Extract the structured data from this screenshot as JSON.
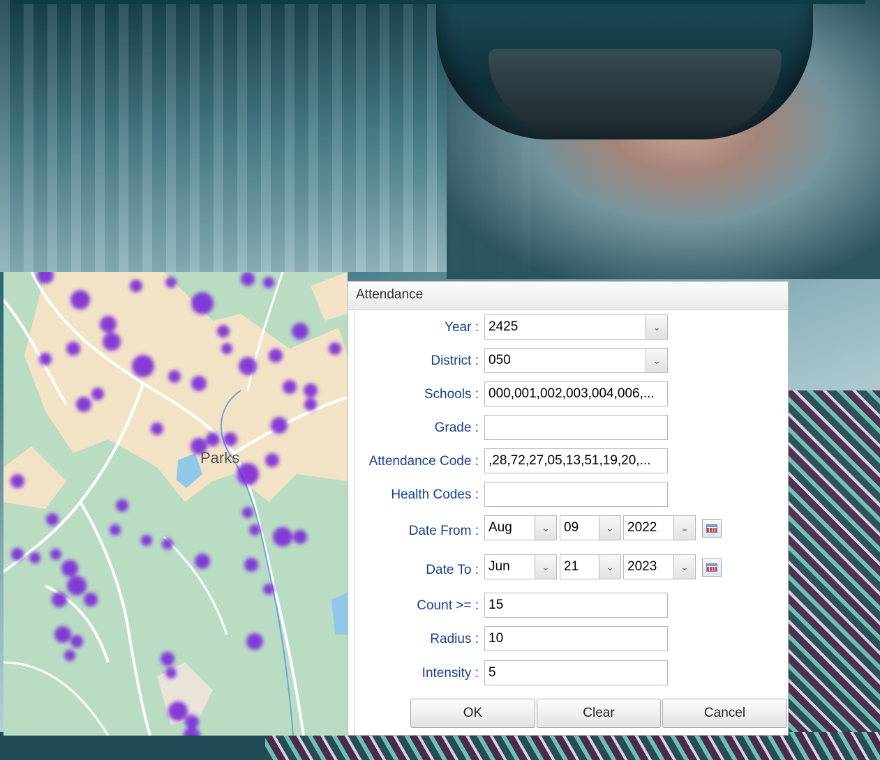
{
  "map": {
    "place_label": "Parks"
  },
  "dialog": {
    "title": "Attendance",
    "fields": {
      "year": {
        "label": "Year :",
        "value": "2425"
      },
      "district": {
        "label": "District :",
        "value": "050"
      },
      "schools": {
        "label": "Schools :",
        "value": "000,001,002,003,004,006,..."
      },
      "grade": {
        "label": "Grade :",
        "value": ""
      },
      "attendance_code": {
        "label": "Attendance Code :",
        "value": ",28,72,27,05,13,51,19,20,..."
      },
      "health_codes": {
        "label": "Health Codes :",
        "value": ""
      },
      "date_from": {
        "label": "Date From :",
        "month": "Aug",
        "day": "09",
        "year": "2022"
      },
      "date_to": {
        "label": "Date To :",
        "month": "Jun",
        "day": "21",
        "year": "2023"
      },
      "count": {
        "label": "Count >= :",
        "value": "15"
      },
      "radius": {
        "label": "Radius :",
        "value": "10"
      },
      "intensity": {
        "label": "Intensity :",
        "value": "5"
      }
    },
    "buttons": {
      "ok": "OK",
      "clear": "Clear",
      "cancel": "Cancel"
    }
  },
  "colors": {
    "label_blue": "#15428b",
    "heat_purple": "#7a2bd9",
    "map_green": "#b9dcc3",
    "map_sand": "#f2e3c6"
  },
  "icons": {
    "dropdown": "chevron-down-icon",
    "calendar": "calendar-icon"
  }
}
